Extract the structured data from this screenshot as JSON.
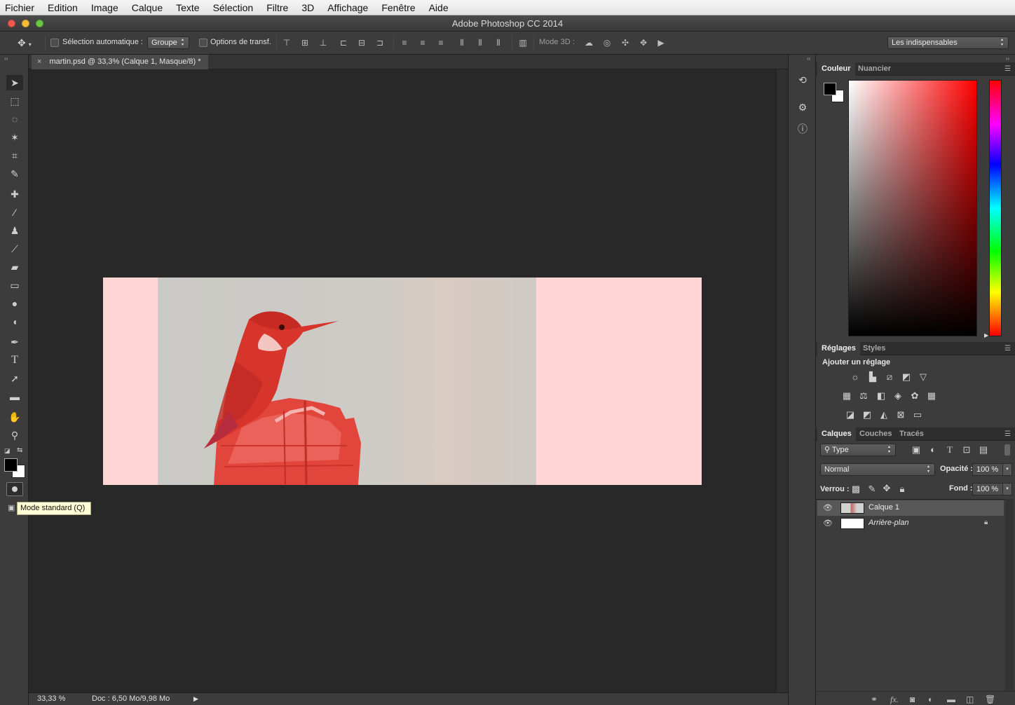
{
  "menubar": {
    "items": [
      "Fichier",
      "Edition",
      "Image",
      "Calque",
      "Texte",
      "Sélection",
      "Filtre",
      "3D",
      "Affichage",
      "Fenêtre",
      "Aide"
    ]
  },
  "window": {
    "title": "Adobe Photoshop CC 2014"
  },
  "options_bar": {
    "auto_select_label": "Sélection automatique :",
    "auto_select_value": "Groupe",
    "transform_options_label": "Options de transf.",
    "mode_3d_label": "Mode 3D :",
    "workspace_value": "Les indispensables"
  },
  "document": {
    "tab_title": "martin.psd @ 33,3% (Calque 1, Masque/8) *",
    "tab_close": "×"
  },
  "tooltip": {
    "text": "Mode standard (Q)"
  },
  "status": {
    "zoom": "33,33 %",
    "doc_size": "Doc : 6,50 Mo/9,98 Mo"
  },
  "color_panel": {
    "tabs": [
      "Couleur",
      "Nuancier"
    ],
    "foreground": "#000000",
    "background": "#ffffff",
    "hue_color": "#ff0000"
  },
  "adjustments_panel": {
    "tabs": [
      "Réglages",
      "Styles"
    ],
    "heading": "Ajouter un réglage"
  },
  "layers_panel": {
    "tabs": [
      "Calques",
      "Couches",
      "Tracés"
    ],
    "filter_value": "Type",
    "blend_mode": "Normal",
    "opacity_label": "Opacité :",
    "opacity_value": "100 %",
    "lock_label": "Verrou :",
    "fill_label": "Fond :",
    "fill_value": "100 %",
    "layers": [
      {
        "name": "Calque 1",
        "selected": true,
        "visible": true
      },
      {
        "name": "Arrière-plan",
        "selected": false,
        "visible": true,
        "locked": true
      }
    ]
  },
  "colors": {
    "mask_overlay": "#ffd5d6",
    "app_bg": "#282828",
    "panel_bg": "#3c3c3c"
  }
}
